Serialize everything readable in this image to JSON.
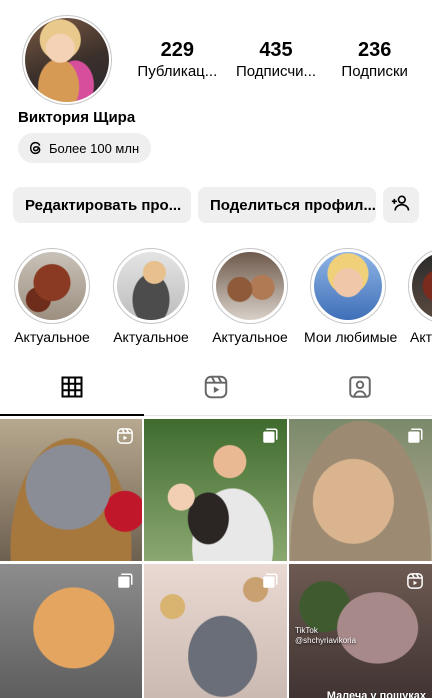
{
  "profile": {
    "name": "Виктория Щира",
    "threads_chip": "Более 100 млн",
    "stats": [
      {
        "value": "229",
        "label": "Публикац..."
      },
      {
        "value": "435",
        "label": "Подписчи..."
      },
      {
        "value": "236",
        "label": "Подписки"
      }
    ]
  },
  "buttons": {
    "edit": "Редактировать про...",
    "share": "Поделиться профил...",
    "add_person_icon": "add-person-icon"
  },
  "highlights": [
    {
      "label": "Актуальное"
    },
    {
      "label": "Актуальное"
    },
    {
      "label": "Актуальное"
    },
    {
      "label": "Мои любимые"
    },
    {
      "label": "Акт"
    }
  ],
  "tabs": [
    {
      "icon": "grid-icon",
      "active": true
    },
    {
      "icon": "reels-icon",
      "active": false
    },
    {
      "icon": "tagged-icon",
      "active": false
    }
  ],
  "posts": [
    {
      "badge": "reel-icon",
      "caption": ""
    },
    {
      "badge": "multiple-icon",
      "caption": ""
    },
    {
      "badge": "multiple-icon",
      "caption": ""
    },
    {
      "badge": "multiple-icon",
      "caption": ""
    },
    {
      "badge": "multiple-icon",
      "caption": ""
    },
    {
      "badge": "reel-icon",
      "caption": "Малеча у пошуках",
      "tiktok_mark": "TikTok",
      "tiktok_user": "@shchyriavikoria"
    }
  ],
  "colors": {
    "button_bg": "#efefef",
    "ring": "#c7c7c7",
    "text": "#000000"
  }
}
